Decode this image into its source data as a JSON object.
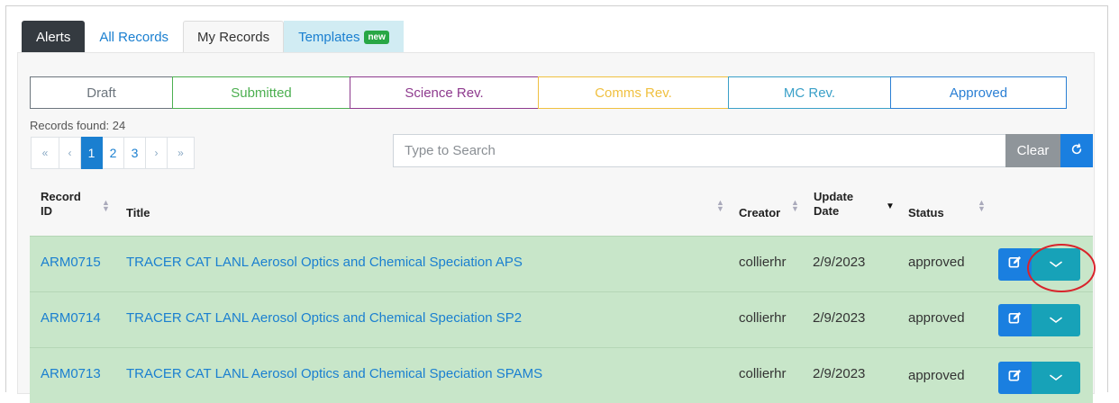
{
  "tabs": [
    {
      "label": "Alerts"
    },
    {
      "label": "All Records"
    },
    {
      "label": "My Records"
    },
    {
      "label": "Templates",
      "badge": "new"
    }
  ],
  "status_filters": [
    {
      "label": "Draft",
      "color": "#6c757d"
    },
    {
      "label": "Submitted",
      "color": "#4caf50"
    },
    {
      "label": "Science Rev.",
      "color": "#8e3a8e"
    },
    {
      "label": "Comms Rev.",
      "color": "#f0c040"
    },
    {
      "label": "MC Rev.",
      "color": "#3aa0c8"
    },
    {
      "label": "Approved",
      "color": "#2a7fd4"
    }
  ],
  "records_found": "Records found: 24",
  "pagination": {
    "first": "«",
    "prev": "‹",
    "pages": [
      "1",
      "2",
      "3"
    ],
    "current": "1",
    "next": "›",
    "last": "»"
  },
  "search": {
    "placeholder": "Type to Search",
    "value": "",
    "clear_label": "Clear"
  },
  "table": {
    "columns": [
      "Record ID",
      "Title",
      "Creator",
      "Update Date",
      "Status"
    ],
    "rows": [
      {
        "id": "ARM0715",
        "title": "TRACER CAT LANL Aerosol Optics and Chemical Speciation APS",
        "creator": "collierhr",
        "date": "2/9/2023",
        "status": "approved"
      },
      {
        "id": "ARM0714",
        "title": "TRACER CAT LANL Aerosol Optics and Chemical Speciation SP2",
        "creator": "collierhr",
        "date": "2/9/2023",
        "status": "approved"
      },
      {
        "id": "ARM0713",
        "title": "TRACER CAT LANL Aerosol Optics and Chemical Speciation SPAMS",
        "creator": "collierhr",
        "date": "2/9/2023",
        "status": "approved"
      }
    ]
  },
  "colors": {
    "accent": "#1a7fd0",
    "row_approved": "#c8e6c9",
    "annotation": "#d9232b"
  },
  "icons": {
    "edit": "edit-icon",
    "expand": "chevron-down-icon",
    "refresh": "refresh-icon"
  }
}
